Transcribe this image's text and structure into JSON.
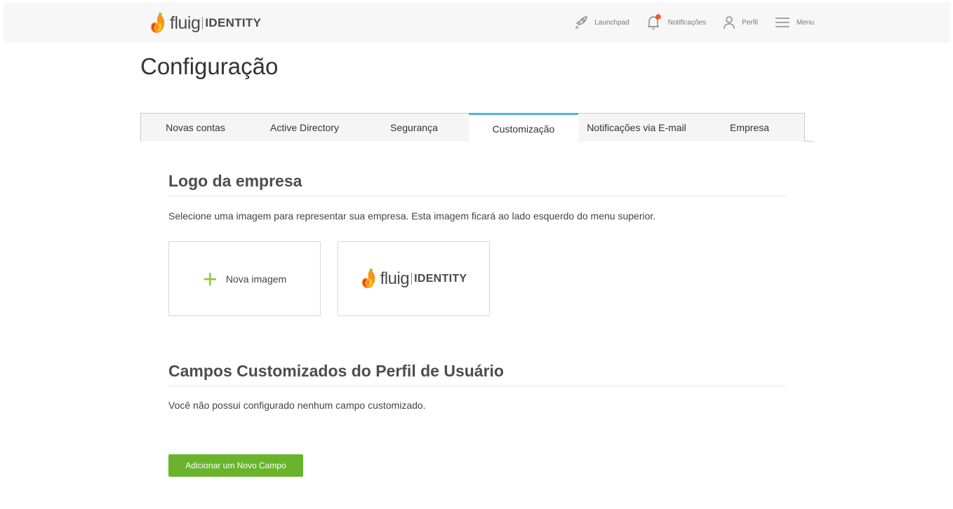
{
  "header": {
    "brand": {
      "name_part": "fluig",
      "product_part": "IDENTITY"
    },
    "nav": [
      {
        "label": "Launchpad",
        "icon": "rocket-icon"
      },
      {
        "label": "Notificações",
        "icon": "bell-icon"
      },
      {
        "label": "Perfil",
        "icon": "user-icon"
      },
      {
        "label": "Menu",
        "icon": "hamburger-icon"
      }
    ],
    "notification_dot_color": "#f15a22"
  },
  "page": {
    "title": "Configuração"
  },
  "tabs": [
    {
      "label": "Novas contas",
      "active": false
    },
    {
      "label": "Active Directory",
      "active": false
    },
    {
      "label": "Segurança",
      "active": false
    },
    {
      "label": "Customização",
      "active": true
    },
    {
      "label": "Notificações via E-mail",
      "active": false
    },
    {
      "label": "Empresa",
      "active": false
    }
  ],
  "logo_section": {
    "title": "Logo da empresa",
    "description": "Selecione uma imagem para representar sua empresa. Esta imagem ficará ao lado esquerdo do menu superior.",
    "new_image_label": "Nova imagem",
    "current_logo": {
      "name_part": "fluig",
      "product_part": "IDENTITY"
    }
  },
  "custom_fields_section": {
    "title": "Campos Customizados do Perfil de Usuário",
    "empty_message": "Você não possui configurado nenhum campo customizado.",
    "add_button_label": "Adicionar um Novo Campo"
  },
  "colors": {
    "accent_tab": "#4fb4d8",
    "primary_button": "#6ab42d",
    "plus_icon": "#8ec63f"
  }
}
